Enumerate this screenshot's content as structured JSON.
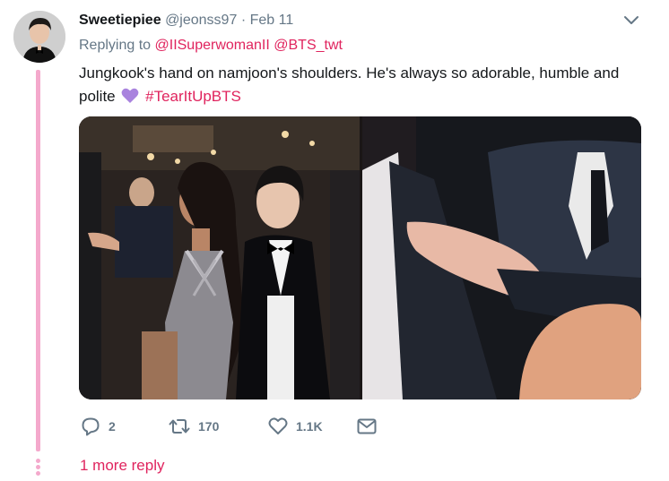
{
  "tweet": {
    "author_name": "Sweetiepiee",
    "author_handle": "@jeonss97",
    "separator": "·",
    "date": "Feb 11",
    "replying_prefix": "Replying to",
    "reply_to": [
      "@IISuperwomanII",
      "@BTS_twt"
    ],
    "text_line1": "Jungkook's hand on namjoon's shoulders. He's always so adorable, humble and",
    "text_line2_prefix": "polite",
    "emoji": "purple-heart",
    "hashtag": "#TearItUpBTS",
    "media_count": 2
  },
  "actions": {
    "reply_count": "2",
    "retweet_count": "170",
    "like_count": "1.1K"
  },
  "thread": {
    "more_replies_label": "1 more reply"
  },
  "colors": {
    "accent": "#e0245e",
    "thread_line": "#f4a9cc",
    "muted": "#657786",
    "emoji_heart": "#a983de"
  }
}
